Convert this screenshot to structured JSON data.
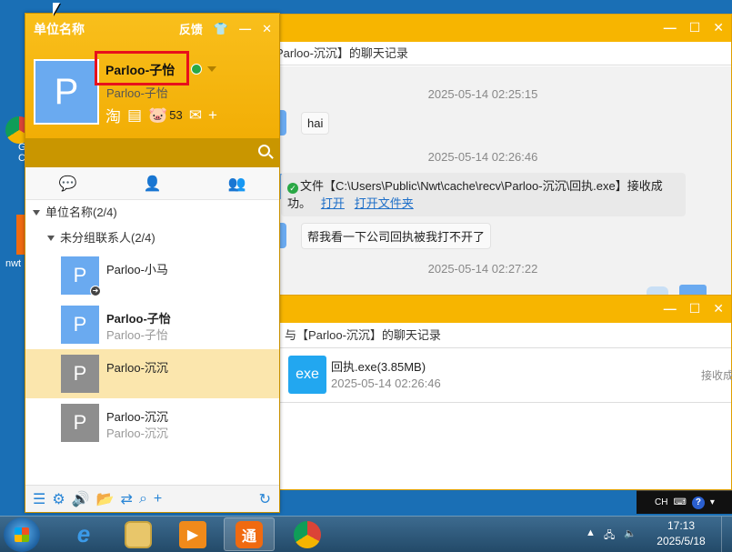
{
  "panel": {
    "org_title": "单位名称",
    "feedback": "反馈",
    "user_name": "Parloo-子怡",
    "user_signature": "Parloo-子怡",
    "points": "53",
    "tree": {
      "group": "单位名称(2/4)",
      "subgroup": "未分组联系人(2/4)"
    },
    "contacts": [
      {
        "name": "Parloo-小马",
        "sub": "",
        "avatar": "P"
      },
      {
        "name": "Parloo-子怡",
        "sub": "Parloo-子怡",
        "avatar": "P"
      },
      {
        "name": "Parloo-沉沉",
        "sub": "",
        "avatar": "P"
      },
      {
        "name": "Parloo-沉沉",
        "sub": "Parloo-沉沉",
        "avatar": "P"
      }
    ],
    "avatar_letter": "P"
  },
  "chat": {
    "header": "Parloo-沉沉】的聊天记录",
    "messages": [
      {
        "ts": "2025-05-14 02:25:15",
        "text": "hai"
      },
      {
        "ts": "2025-05-14 02:26:46",
        "text_line1": "文件【C:\\Users\\Public\\Nwt\\cache\\recv\\Parloo-沉沉\\回执.exe】接收成",
        "text_line2": "功。",
        "link_open": "打开",
        "link_folder": "打开文件夹"
      },
      {
        "text": "帮我看一下公司回执被我打不开了"
      },
      {
        "ts": "2025-05-14 02:27:22"
      }
    ]
  },
  "history": {
    "header": "与【Parloo-沉沉】的聊天记录",
    "file": {
      "icon_text": "exe",
      "name": "回执.exe(3.85MB)",
      "date": "2025-05-14 02:26:46",
      "status": "接收成"
    }
  },
  "desktop": {
    "icon1_label": "G",
    "icon1_label2": "C",
    "icon2_label": "nwt"
  },
  "tray": {
    "lang": "CH"
  },
  "taskbar": {
    "time": "17:13",
    "date": "2025/5/18"
  },
  "colors": {
    "accent": "#f7b500",
    "contact_avatar_blue": "#6aaaf0",
    "contact_avatar_gray": "#8e8e8e",
    "selection": "#fbe6ad",
    "highlight_box": "#e8101c",
    "link": "#1e6fc8"
  }
}
